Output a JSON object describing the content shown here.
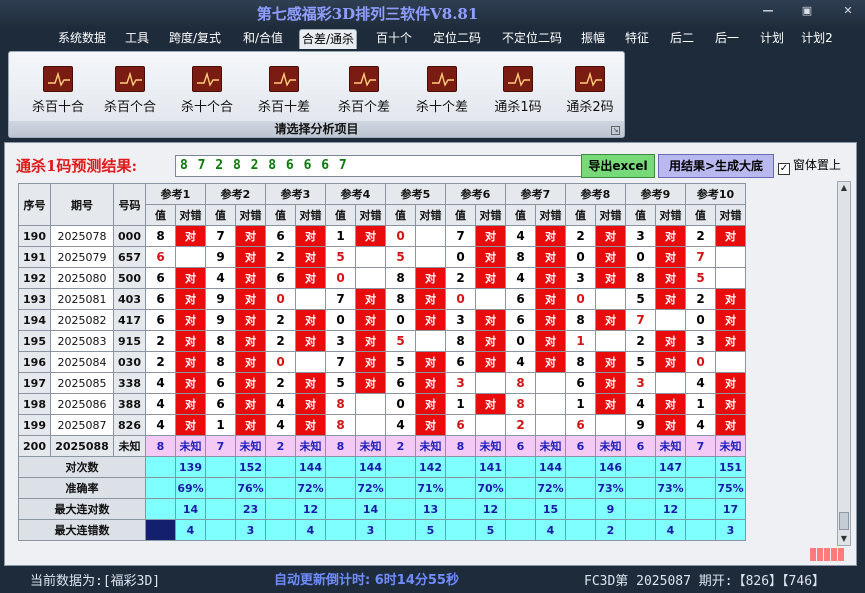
{
  "window": {
    "title": "第七感福彩3D排列三软件V8.81",
    "btn_min": "—",
    "btn_max": "▣",
    "btn_close": "✕"
  },
  "menu": [
    {
      "label": "系统数据"
    },
    {
      "label": "工具"
    },
    {
      "label": "跨度/复式"
    },
    {
      "label": "和/合值"
    },
    {
      "label": "合差/通杀",
      "active": true
    },
    {
      "label": "百十个"
    },
    {
      "label": "定位二码"
    },
    {
      "label": "不定位二码"
    },
    {
      "label": "振幅"
    },
    {
      "label": "特征"
    },
    {
      "label": "后二"
    },
    {
      "label": "后一"
    },
    {
      "label": "计划"
    },
    {
      "label": "计划2"
    }
  ],
  "ribbon": {
    "buttons": [
      {
        "label": "杀百十合",
        "icon": "chart-icon"
      },
      {
        "label": "杀百个合",
        "icon": "chart-icon"
      },
      {
        "label": "杀十个合",
        "icon": "chart-icon"
      },
      {
        "label": "杀百十差",
        "icon": "chart-icon"
      },
      {
        "label": "杀百个差",
        "icon": "chart-icon"
      },
      {
        "label": "杀十个差",
        "icon": "chart-icon"
      },
      {
        "label": "通杀1码",
        "icon": "chart-icon"
      },
      {
        "label": "通杀2码",
        "icon": "chart-icon"
      }
    ],
    "caption": "请选择分析项目"
  },
  "prediction": {
    "label": "通杀1码预测结果:",
    "value": "8 7 2 8 2 8 6 6 6 7",
    "export_btn": "导出excel",
    "generate_btn": "用结果>生成大底",
    "topmost_label": "窗体置上",
    "topmost_checked": true
  },
  "table": {
    "headers": {
      "seq": "序号",
      "period": "期号",
      "num": "号码"
    },
    "refs": [
      "参考1",
      "参考2",
      "参考3",
      "参考4",
      "参考5",
      "参考6",
      "参考7",
      "参考8",
      "参考9",
      "参考10"
    ],
    "subhead_value": "值",
    "subhead_result": "对错",
    "hit_text": "对",
    "rows": [
      {
        "seq": "190",
        "period": "2025078",
        "num": "000",
        "vals": [
          "8",
          "7",
          "6",
          "1",
          "0",
          "7",
          "4",
          "2",
          "3",
          "2"
        ],
        "hits": [
          1,
          1,
          1,
          1,
          0,
          1,
          1,
          1,
          1,
          1
        ]
      },
      {
        "seq": "191",
        "period": "2025079",
        "num": "657",
        "vals": [
          "6",
          "9",
          "2",
          "5",
          "5",
          "0",
          "8",
          "0",
          "0",
          "7"
        ],
        "hits": [
          0,
          1,
          1,
          0,
          0,
          1,
          1,
          1,
          1,
          0
        ]
      },
      {
        "seq": "192",
        "period": "2025080",
        "num": "500",
        "vals": [
          "6",
          "4",
          "6",
          "0",
          "8",
          "2",
          "4",
          "3",
          "8",
          "5"
        ],
        "hits": [
          1,
          1,
          1,
          0,
          1,
          1,
          1,
          1,
          1,
          0
        ]
      },
      {
        "seq": "193",
        "period": "2025081",
        "num": "403",
        "vals": [
          "6",
          "9",
          "0",
          "7",
          "8",
          "0",
          "6",
          "0",
          "5",
          "2"
        ],
        "hits": [
          1,
          1,
          0,
          1,
          1,
          0,
          1,
          0,
          1,
          1
        ]
      },
      {
        "seq": "194",
        "period": "2025082",
        "num": "417",
        "vals": [
          "6",
          "9",
          "2",
          "0",
          "0",
          "3",
          "6",
          "8",
          "7",
          "0"
        ],
        "hits": [
          1,
          1,
          1,
          1,
          1,
          1,
          1,
          1,
          0,
          1
        ]
      },
      {
        "seq": "195",
        "period": "2025083",
        "num": "915",
        "vals": [
          "2",
          "8",
          "2",
          "3",
          "5",
          "8",
          "0",
          "1",
          "2",
          "3"
        ],
        "hits": [
          1,
          1,
          1,
          1,
          0,
          1,
          1,
          0,
          1,
          1
        ]
      },
      {
        "seq": "196",
        "period": "2025084",
        "num": "030",
        "vals": [
          "2",
          "8",
          "0",
          "7",
          "5",
          "6",
          "4",
          "8",
          "5",
          "0"
        ],
        "hits": [
          1,
          1,
          0,
          1,
          1,
          1,
          1,
          1,
          1,
          0
        ]
      },
      {
        "seq": "197",
        "period": "2025085",
        "num": "338",
        "vals": [
          "4",
          "6",
          "2",
          "5",
          "6",
          "3",
          "8",
          "6",
          "3",
          "4"
        ],
        "hits": [
          1,
          1,
          1,
          1,
          1,
          0,
          0,
          1,
          0,
          1
        ]
      },
      {
        "seq": "198",
        "period": "2025086",
        "num": "388",
        "vals": [
          "4",
          "6",
          "4",
          "8",
          "0",
          "1",
          "8",
          "1",
          "4",
          "1"
        ],
        "hits": [
          1,
          1,
          1,
          0,
          1,
          1,
          0,
          1,
          1,
          1
        ]
      },
      {
        "seq": "199",
        "period": "2025087",
        "num": "826",
        "vals": [
          "4",
          "1",
          "4",
          "8",
          "4",
          "6",
          "2",
          "6",
          "9",
          "4"
        ],
        "hits": [
          1,
          1,
          1,
          0,
          1,
          0,
          0,
          0,
          1,
          1
        ]
      }
    ],
    "pred_row": {
      "seq": "200",
      "period": "2025088",
      "num": "未知",
      "vals": [
        "8",
        "7",
        "2",
        "8",
        "2",
        "8",
        "6",
        "6",
        "6",
        "7"
      ],
      "unknown": "未知"
    },
    "stats": [
      {
        "label": "对次数",
        "vals": [
          "139",
          "152",
          "144",
          "144",
          "142",
          "141",
          "144",
          "146",
          "147",
          "151"
        ]
      },
      {
        "label": "准确率",
        "vals": [
          "69%",
          "76%",
          "72%",
          "72%",
          "71%",
          "70%",
          "72%",
          "73%",
          "73%",
          "75%"
        ]
      },
      {
        "label": "最大连对数",
        "vals": [
          "14",
          "23",
          "12",
          "14",
          "13",
          "12",
          "15",
          "9",
          "12",
          "17"
        ]
      },
      {
        "label": "最大连错数",
        "vals": [
          "4",
          "3",
          "4",
          "3",
          "5",
          "5",
          "4",
          "2",
          "4",
          "3"
        ]
      }
    ]
  },
  "status": {
    "current_data": "当前数据为:[福彩3D]",
    "countdown": "自动更新倒计时:  6时14分55秒",
    "issue": "FC3D第 2025087 期开:【826】【746】"
  },
  "colors": {
    "hit": "#e80c0c",
    "stat_bg": "#7fffff",
    "pred_bg": "#f5c9f5",
    "title": "#8f9eff"
  }
}
